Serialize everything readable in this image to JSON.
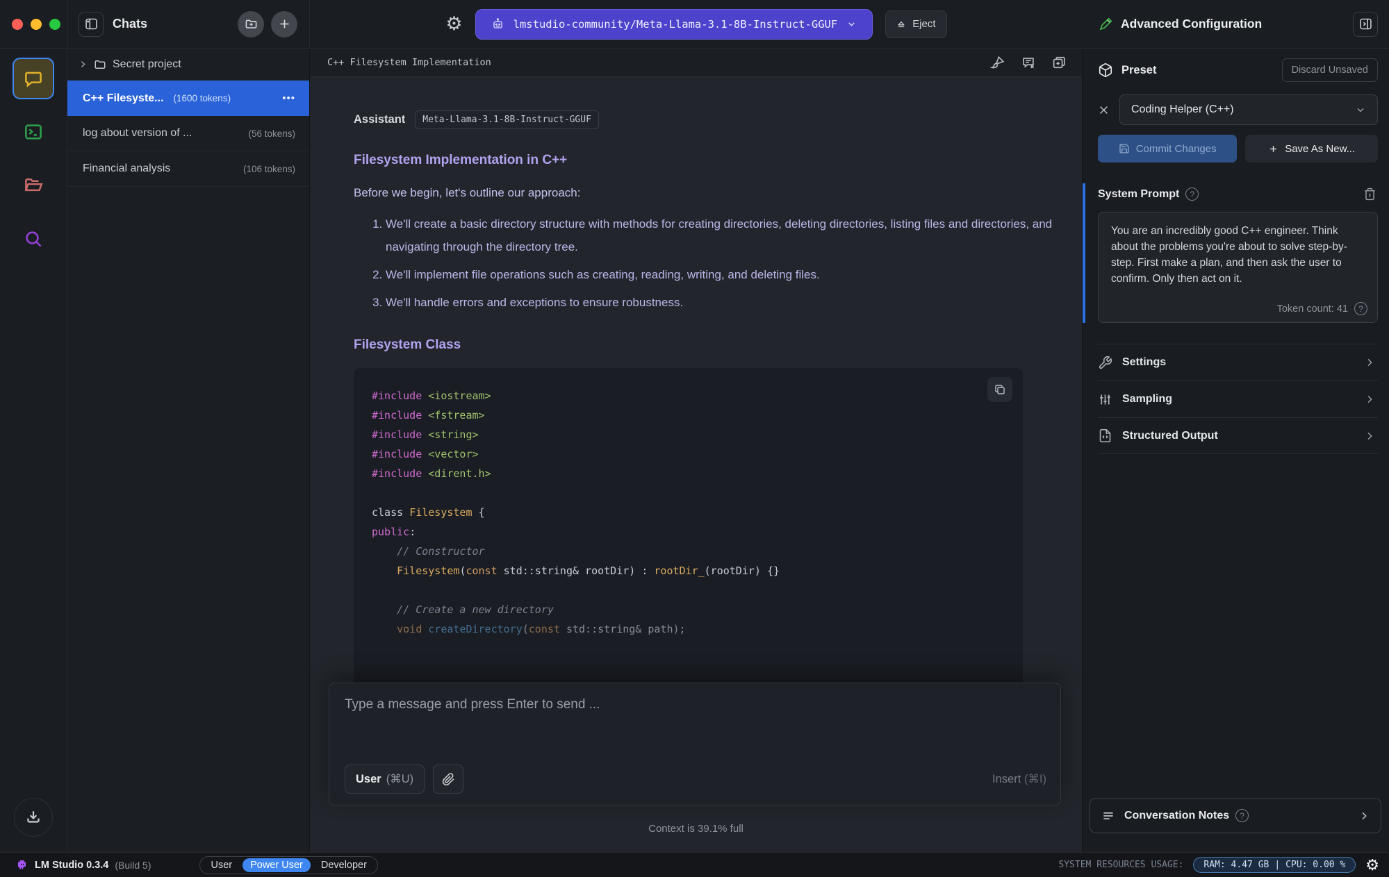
{
  "window": {
    "controls": [
      "close",
      "minimize",
      "zoom"
    ]
  },
  "topbar": {
    "sidebar_title": "Chats",
    "model_name": "lmstudio-community/Meta-Llama-3.1-8B-Instruct-GGUF",
    "eject_label": "Eject",
    "panel_title": "Advanced Configuration"
  },
  "icons": {
    "gear": "⚙",
    "ellipsis": "•••",
    "help": "?",
    "close": "✕",
    "plus": "+",
    "command": "⌘"
  },
  "rail": {
    "items": [
      "chat",
      "terminal",
      "files",
      "search"
    ],
    "active": "chat",
    "download": "download"
  },
  "sidebar": {
    "folder": {
      "name": "Secret project"
    },
    "chats": [
      {
        "title": "C++ Filesyste...",
        "tokens": "(1600 tokens)",
        "selected": true
      },
      {
        "title": "log about version of ...",
        "tokens": "(56 tokens)",
        "selected": false
      },
      {
        "title": "Financial analysis",
        "tokens": "(106 tokens)",
        "selected": false
      }
    ]
  },
  "chat": {
    "title": "C++ Filesystem Implementation",
    "assistant_label": "Assistant",
    "model_badge": "Meta-Llama-3.1-8B-Instruct-GGUF",
    "heading1": "Filesystem Implementation in C++",
    "intro": "Before we begin, let's outline our approach:",
    "approach_list": [
      "We'll create a basic directory structure with methods for creating directories, deleting directories, listing files and directories, and navigating through the directory tree.",
      "We'll implement file operations such as creating, reading, writing, and deleting files.",
      "We'll handle errors and exceptions to ensure robustness."
    ],
    "heading2": "Filesystem Class",
    "code": {
      "language": "cpp",
      "token_colors": {
        "preprocessor": "#cf6ad1",
        "header": "#9fc16b",
        "type": "#dcab62",
        "keyword": "#d19a66",
        "comment": "#7b8290",
        "function": "#5b9fd4",
        "plain": "#c9ced6"
      },
      "lines": [
        {
          "tokens": [
            [
              "t-pp",
              "#include"
            ],
            [
              "t-pl",
              " "
            ],
            [
              "t-inc",
              "<iostream>"
            ]
          ]
        },
        {
          "tokens": [
            [
              "t-pp",
              "#include"
            ],
            [
              "t-pl",
              " "
            ],
            [
              "t-inc",
              "<fstream>"
            ]
          ]
        },
        {
          "tokens": [
            [
              "t-pp",
              "#include"
            ],
            [
              "t-pl",
              " "
            ],
            [
              "t-inc",
              "<string>"
            ]
          ]
        },
        {
          "tokens": [
            [
              "t-pp",
              "#include"
            ],
            [
              "t-pl",
              " "
            ],
            [
              "t-inc",
              "<vector>"
            ]
          ]
        },
        {
          "tokens": [
            [
              "t-pp",
              "#include"
            ],
            [
              "t-pl",
              " "
            ],
            [
              "t-inc",
              "<dirent.h>"
            ]
          ]
        },
        {
          "tokens": []
        },
        {
          "tokens": [
            [
              "t-pl",
              "class "
            ],
            [
              "t-type",
              "Filesystem"
            ],
            [
              "t-pl",
              " {"
            ]
          ]
        },
        {
          "tokens": [
            [
              "t-pp",
              "public"
            ],
            [
              "t-pl",
              ":"
            ]
          ]
        },
        {
          "tokens": [
            [
              "t-cmt",
              "    // Constructor"
            ]
          ]
        },
        {
          "tokens": [
            [
              "t-pl",
              "    "
            ],
            [
              "t-type",
              "Filesystem"
            ],
            [
              "t-pl",
              "("
            ],
            [
              "t-kw2",
              "const"
            ],
            [
              "t-pl",
              " std::string& rootDir) : "
            ],
            [
              "t-type",
              "rootDir_"
            ],
            [
              "t-pl",
              "(rootDir) {}"
            ]
          ]
        },
        {
          "tokens": []
        },
        {
          "tokens": [
            [
              "t-cmt",
              "    // Create a new directory"
            ]
          ]
        },
        {
          "tokens": [
            [
              "t-kw2",
              "    void "
            ],
            [
              "t-fn",
              "createDirectory"
            ],
            [
              "t-pl",
              "("
            ],
            [
              "t-kw2",
              "const"
            ],
            [
              "t-pl",
              " std::string& path);"
            ]
          ],
          "dim": true
        }
      ]
    }
  },
  "composer": {
    "placeholder": "Type a message and press Enter to send ...",
    "role_button": "User",
    "role_shortcut": "(⌘U)",
    "insert_label": "Insert",
    "insert_shortcut": "(⌘I)",
    "context_status": "Context is 39.1% full"
  },
  "panel": {
    "preset": {
      "label": "Preset",
      "discard_label": "Discard Unsaved",
      "selected_value": "Coding Helper (C++)",
      "commit_label": "Commit Changes",
      "save_as_label": "Save As New..."
    },
    "system_prompt": {
      "label": "System Prompt",
      "text": "You are an incredibly good C++ engineer. Think about the problems you're about to solve step-by-step. First make a plan, and then ask the user to confirm. Only then act on it.",
      "token_count": "Token count: 41"
    },
    "sections": [
      {
        "label": "Settings",
        "icon": "wrench"
      },
      {
        "label": "Sampling",
        "icon": "sliders"
      },
      {
        "label": "Structured Output",
        "icon": "structured"
      }
    ],
    "notes_label": "Conversation Notes"
  },
  "statusbar": {
    "app_name": "LM Studio 0.3.4",
    "build": "(Build 5)",
    "modes": [
      "User",
      "Power User",
      "Developer"
    ],
    "active_mode": "Power User",
    "resources_label": "SYSTEM RESOURCES USAGE:",
    "ram": "RAM: 4.47 GB",
    "divider": "|",
    "cpu": "CPU: 0.00 %"
  },
  "colors": {
    "selection_blue": "#2a62d9",
    "model_pill_purple": "#4c42cb",
    "active_mode_blue": "#3e87f0",
    "accent_stripe_blue": "#2b6fe4",
    "heading_purple": "#b1a3f0",
    "markdown_purple": "#bcb5e9",
    "rail_chat_yellow": "#e0b32c",
    "rail_terminal_green": "#2ca34c",
    "rail_folder_red": "#c96b6b",
    "rail_search_purple": "#9240d6",
    "logo_purple": "#a855f7",
    "pencil_green": "#3fae4a",
    "traffic_red": "#ff5f57",
    "traffic_yellow": "#febc2e",
    "traffic_green": "#28c840"
  }
}
